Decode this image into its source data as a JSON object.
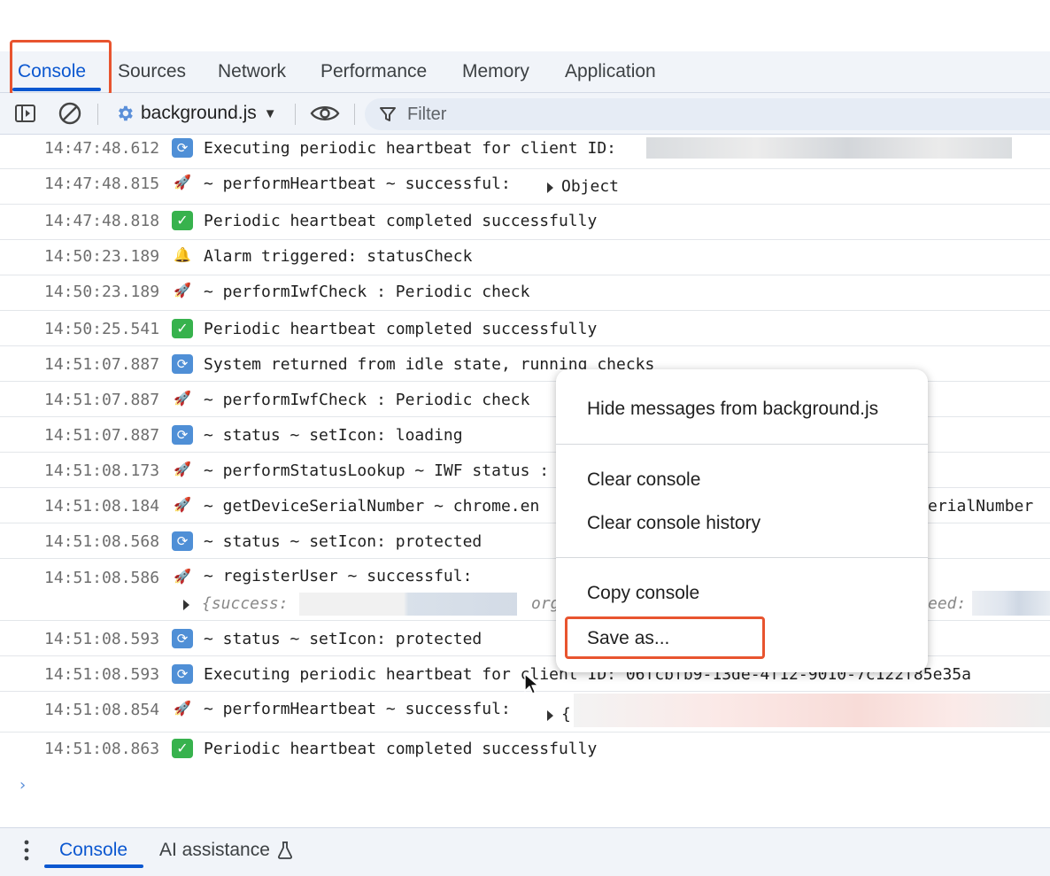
{
  "tabs": [
    {
      "label": "Console",
      "active": true
    },
    {
      "label": "Sources"
    },
    {
      "label": "Network"
    },
    {
      "label": "Performance"
    },
    {
      "label": "Memory"
    },
    {
      "label": "Application"
    }
  ],
  "toolbar": {
    "context": "background.js",
    "filter_placeholder": "Filter"
  },
  "log": [
    {
      "time": "14:47:48.612",
      "icon": "sync-icon",
      "text": "Executing periodic heartbeat for client ID:"
    },
    {
      "time": "14:47:48.815",
      "icon": "rocket-icon",
      "text": "~ performHeartbeat ~ successful:",
      "extra": "Object"
    },
    {
      "time": "14:47:48.818",
      "icon": "check-icon",
      "text": "Periodic heartbeat completed successfully"
    },
    {
      "time": "14:50:23.189",
      "icon": "bell-icon",
      "text": "Alarm triggered: statusCheck"
    },
    {
      "time": "14:50:23.189",
      "icon": "rocket-icon",
      "text": "~ performIwfCheck : Periodic check"
    },
    {
      "time": "14:50:25.541",
      "icon": "check-icon",
      "text": "Periodic heartbeat completed successfully"
    },
    {
      "time": "14:51:07.887",
      "icon": "sync-icon",
      "text": "System returned from idle state, running checks"
    },
    {
      "time": "14:51:07.887",
      "icon": "rocket-icon",
      "text": "~ performIwfCheck : Periodic check"
    },
    {
      "time": "14:51:07.887",
      "icon": "sync-icon",
      "text": "~ status ~ setIcon:  loading"
    },
    {
      "time": "14:51:08.173",
      "icon": "rocket-icon",
      "text": "~ performStatusLookup ~ IWF status :"
    },
    {
      "time": "14:51:08.184",
      "icon": "rocket-icon",
      "text": "~ getDeviceSerialNumber ~  chrome.en",
      "tail": "erialNumber"
    },
    {
      "time": "14:51:08.568",
      "icon": "sync-icon",
      "text": "~ status ~ setIcon:  protected"
    },
    {
      "time": "14:51:08.586",
      "icon": "rocket-icon",
      "text": "~ registerUser ~ successful:",
      "obj1": "{success:",
      "obj2": "org",
      "obj3": "eed:"
    },
    {
      "time": "14:51:08.593",
      "icon": "sync-icon",
      "text": "~ status ~ setIcon:  protected"
    },
    {
      "time": "14:51:08.593",
      "icon": "sync-icon",
      "text": "Executing periodic heartbeat for client ID: 06fcbfb9-13de-4f12-9010-7c122f85e35a"
    },
    {
      "time": "14:51:08.854",
      "icon": "rocket-icon",
      "text": "~ performHeartbeat ~ successful:",
      "extra": "{"
    },
    {
      "time": "14:51:08.863",
      "icon": "check-icon",
      "text": "Periodic heartbeat completed successfully"
    }
  ],
  "prompt": "›",
  "context_menu": {
    "hide": "Hide messages from background.js",
    "clear": "Clear console",
    "clear_history": "Clear console history",
    "copy": "Copy console",
    "save": "Save as..."
  },
  "drawer": {
    "console": "Console",
    "ai": "AI assistance"
  },
  "colors": {
    "accent": "#0b57d0",
    "highlight": "#e8542f"
  }
}
